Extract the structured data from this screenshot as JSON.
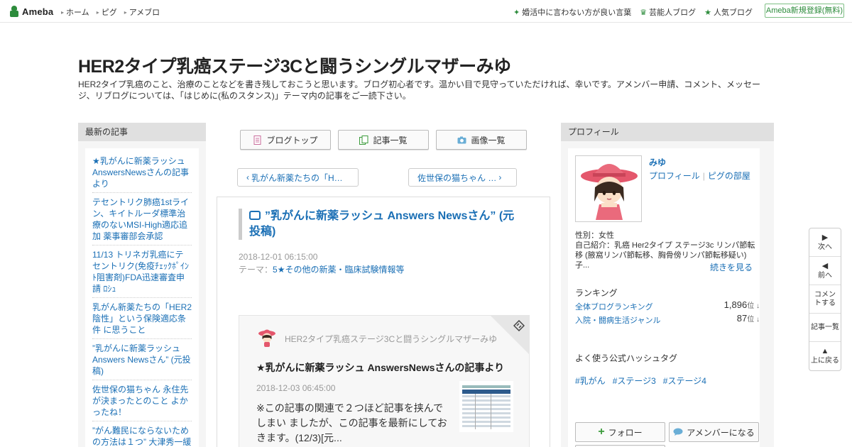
{
  "topbar": {
    "brand": "Ameba",
    "nav": [
      "ホーム",
      "ピグ",
      "アメブロ"
    ],
    "links": [
      {
        "icon": "sparkle-icon",
        "label": "婚活中に言わない方が良い言葉"
      },
      {
        "icon": "crown-icon",
        "label": "芸能人ブログ"
      },
      {
        "icon": "star-icon",
        "label": "人気ブログ"
      }
    ],
    "signup": "Ameba新規登録(無料)"
  },
  "header": {
    "title": "HER2タイプ乳癌ステージ3Cと闘うシングルマザーみゆ",
    "description": "HER2タイプ乳癌のこと、治療のことなどを書き残しておこうと思います。ブログ初心者です。温かい目で見守っていただければ、幸いです。アメンバー申請、コメント、メッセージ、リブログについては、「はじめに(私のスタンス)」テーマ内の記事をご一読下さい。"
  },
  "left_sidebar": {
    "heading": "最新の記事",
    "items": [
      "★乳がんに新薬ラッシュ AnswersNewsさんの記事より",
      "テセントリク肺癌1stライン、キイトルーダ標準治療のないMSI-High適応追加 薬事審部会承認",
      "11/13 トリネガ乳癌にテセントリク(免疫ﾁｪｯｸﾎﾟｲﾝﾄ阻害剤)FDA迅速審査申請 ﾛｼｭ",
      "乳がん新薬たちの「HER2陰性」という保険適応条件 に思うこと",
      "”乳がんに新薬ラッシュ Answers Newsさん” (元投稿)",
      "佐世保の猫ちゃん 永住先が決まったとのこと よかったね！",
      "”がん難民にならないための方法は１つ” 大津秀一緩和医"
    ]
  },
  "tabs": [
    {
      "label": "ブログトップ",
      "icon": "document-icon"
    },
    {
      "label": "記事一覧",
      "icon": "list-icon"
    },
    {
      "label": "画像一覧",
      "icon": "camera-icon"
    }
  ],
  "pager": {
    "prev": "乳がん新薬たちの「H…",
    "next": "佐世保の猫ちゃん …"
  },
  "article": {
    "title": "”乳がんに新薬ラッシュ Answers Newsさん” (元投稿)",
    "date": "2018-12-01 06:15:00",
    "theme_label": "テーマ：",
    "theme": "5★その他の新薬・臨床試験情報等",
    "reblog": {
      "blog_name": "HER2タイプ乳癌ステージ3Cと闘うシングルマザーみゆ",
      "title": "★乳がんに新薬ラッシュ AnswersNewsさんの記事より",
      "date": "2018-12-03 06:45:00",
      "excerpt": "※この記事の関連で２つほど記事を挟んでしまい ましたが、この記事を最新にしておきます。(12/3)[元..."
    }
  },
  "profile": {
    "heading": "プロフィール",
    "name": "みゆ",
    "link_profile": "プロフィール",
    "link_room": "ピグの部屋",
    "gender": "性別：女性",
    "intro": "自己紹介：乳癌 Her2タイプ ステージ3c リンパ節転移 (腋窩リンパ節転移、胸骨傍リンパ節転移疑い) 子...",
    "more": "続きを見る",
    "ranking_heading": "ランキング",
    "rankings": [
      {
        "label": "全体ブログランキング",
        "value": "1,896",
        "unit": "位 ↓"
      },
      {
        "label": "入院・闘病生活ジャンル",
        "value": "87",
        "unit": "位 ↓"
      }
    ],
    "hashtag_heading": "よく使う公式ハッシュタグ",
    "hashtags": [
      "#乳がん",
      "#ステージ3",
      "#ステージ4"
    ],
    "follow": "フォロー",
    "amember": "アメンバーになる"
  },
  "floatnav": [
    {
      "icon": "play-icon",
      "label": "次へ"
    },
    {
      "icon": "back-icon",
      "label": "前へ"
    },
    {
      "icon": "",
      "label": "コメントする"
    },
    {
      "icon": "",
      "label": "記事一覧"
    },
    {
      "icon": "up-icon",
      "label": "上に戻る"
    }
  ],
  "colors": {
    "accent": "#2d8c3c",
    "link": "#1a6fb5",
    "panel": "#f5f5f5"
  }
}
